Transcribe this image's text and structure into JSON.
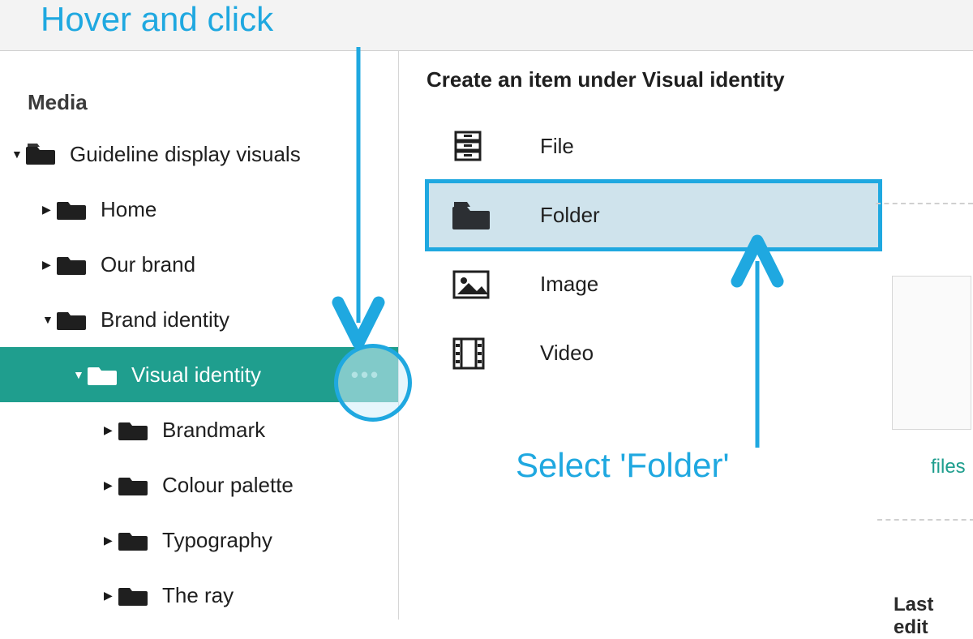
{
  "annotations": {
    "hover": "Hover and click",
    "select": "Select 'Folder'"
  },
  "sidebar": {
    "heading": "Media",
    "root": {
      "label": "Guideline display visuals"
    },
    "items": {
      "home": "Home",
      "our_brand": "Our brand",
      "brand_identity": "Brand identity",
      "visual_identity": "Visual identity",
      "brandmark": "Brandmark",
      "colour_palette": "Colour palette",
      "typography": "Typography",
      "the_ray": "The ray"
    }
  },
  "panel": {
    "title": "Create an item under Visual identity",
    "options": {
      "file": "File",
      "folder": "Folder",
      "image": "Image",
      "video": "Video"
    }
  },
  "ghost": {
    "files": "files",
    "last": "Last edit"
  }
}
